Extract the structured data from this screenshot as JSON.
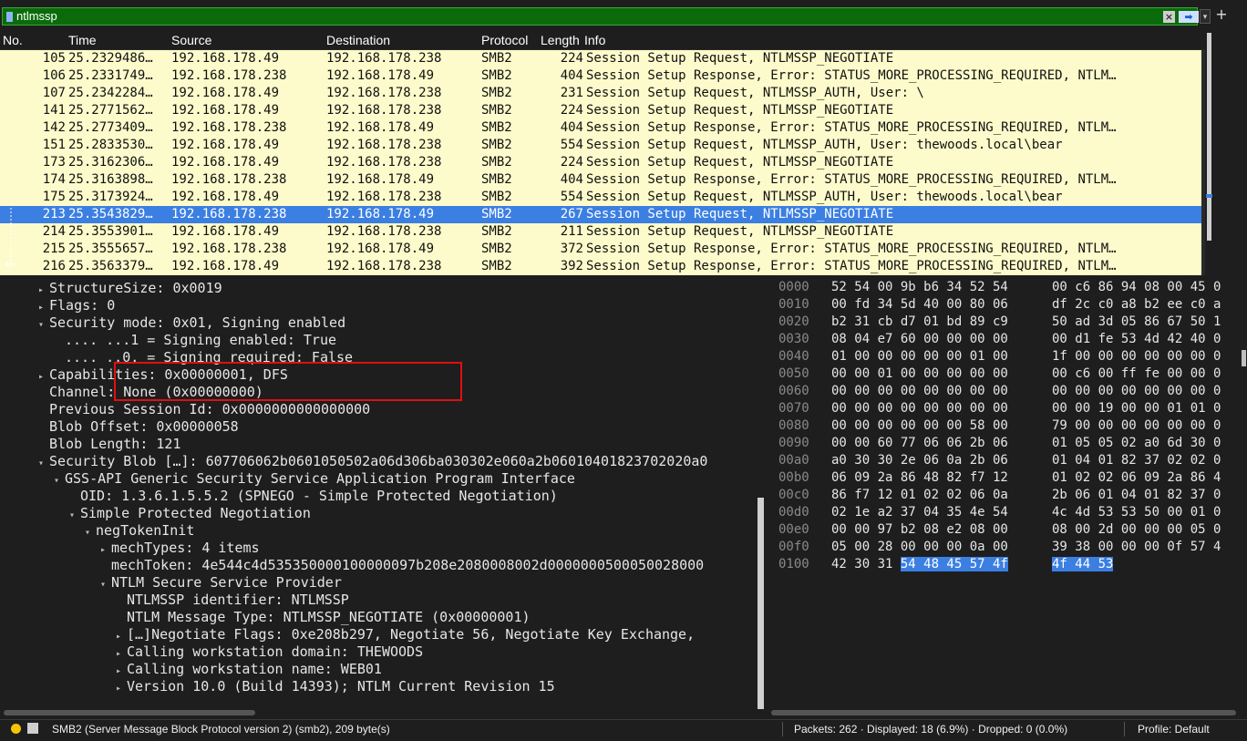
{
  "filter": {
    "value": "ntlmssp"
  },
  "columns": [
    "No.",
    "Time",
    "Source",
    "Destination",
    "Protocol",
    "Length",
    "Info"
  ],
  "packets": [
    {
      "no": "105",
      "time": "25.2329486…",
      "src": "192.168.178.49",
      "dst": "192.168.178.238",
      "proto": "SMB2",
      "len": "224",
      "info": "Session Setup Request, NTLMSSP_NEGOTIATE"
    },
    {
      "no": "106",
      "time": "25.2331749…",
      "src": "192.168.178.238",
      "dst": "192.168.178.49",
      "proto": "SMB2",
      "len": "404",
      "info": "Session Setup Response, Error: STATUS_MORE_PROCESSING_REQUIRED, NTLM…"
    },
    {
      "no": "107",
      "time": "25.2342284…",
      "src": "192.168.178.49",
      "dst": "192.168.178.238",
      "proto": "SMB2",
      "len": "231",
      "info": "Session Setup Request, NTLMSSP_AUTH, User: \\"
    },
    {
      "no": "141",
      "time": "25.2771562…",
      "src": "192.168.178.49",
      "dst": "192.168.178.238",
      "proto": "SMB2",
      "len": "224",
      "info": "Session Setup Request, NTLMSSP_NEGOTIATE"
    },
    {
      "no": "142",
      "time": "25.2773409…",
      "src": "192.168.178.238",
      "dst": "192.168.178.49",
      "proto": "SMB2",
      "len": "404",
      "info": "Session Setup Response, Error: STATUS_MORE_PROCESSING_REQUIRED, NTLM…"
    },
    {
      "no": "151",
      "time": "25.2833530…",
      "src": "192.168.178.49",
      "dst": "192.168.178.238",
      "proto": "SMB2",
      "len": "554",
      "info": "Session Setup Request, NTLMSSP_AUTH, User: thewoods.local\\bear"
    },
    {
      "no": "173",
      "time": "25.3162306…",
      "src": "192.168.178.49",
      "dst": "192.168.178.238",
      "proto": "SMB2",
      "len": "224",
      "info": "Session Setup Request, NTLMSSP_NEGOTIATE"
    },
    {
      "no": "174",
      "time": "25.3163898…",
      "src": "192.168.178.238",
      "dst": "192.168.178.49",
      "proto": "SMB2",
      "len": "404",
      "info": "Session Setup Response, Error: STATUS_MORE_PROCESSING_REQUIRED, NTLM…"
    },
    {
      "no": "175",
      "time": "25.3173924…",
      "src": "192.168.178.49",
      "dst": "192.168.178.238",
      "proto": "SMB2",
      "len": "554",
      "info": "Session Setup Request, NTLMSSP_AUTH, User: thewoods.local\\bear"
    },
    {
      "no": "213",
      "time": "25.3543829…",
      "src": "192.168.178.238",
      "dst": "192.168.178.49",
      "proto": "SMB2",
      "len": "267",
      "info": "Session Setup Request, NTLMSSP_NEGOTIATE"
    },
    {
      "no": "214",
      "time": "25.3553901…",
      "src": "192.168.178.49",
      "dst": "192.168.178.238",
      "proto": "SMB2",
      "len": "211",
      "info": "Session Setup Request, NTLMSSP_NEGOTIATE"
    },
    {
      "no": "215",
      "time": "25.3555657…",
      "src": "192.168.178.238",
      "dst": "192.168.178.49",
      "proto": "SMB2",
      "len": "372",
      "info": "Session Setup Response, Error: STATUS_MORE_PROCESSING_REQUIRED, NTLM…"
    },
    {
      "no": "216",
      "time": "25.3563379…",
      "src": "192.168.178.49",
      "dst": "192.168.178.238",
      "proto": "SMB2",
      "len": "392",
      "info": "Session Setup Response, Error: STATUS_MORE_PROCESSING_REQUIRED, NTLM…"
    }
  ],
  "selected_packet": "213",
  "details": [
    {
      "indent": 0,
      "tri": "right",
      "text": "StructureSize: 0x0019"
    },
    {
      "indent": 0,
      "tri": "right",
      "text": "Flags: 0"
    },
    {
      "indent": 0,
      "tri": "down",
      "text": "Security mode: 0x01, Signing enabled"
    },
    {
      "indent": 1,
      "tri": "none",
      "text": ".... ...1 = Signing enabled: True"
    },
    {
      "indent": 1,
      "tri": "none",
      "text": ".... ..0. = Signing required: False"
    },
    {
      "indent": 0,
      "tri": "right",
      "text": "Capabilities: 0x00000001, DFS"
    },
    {
      "indent": 0,
      "tri": "none",
      "text": "Channel: None (0x00000000)"
    },
    {
      "indent": 0,
      "tri": "none",
      "text": "Previous Session Id: 0x0000000000000000"
    },
    {
      "indent": 0,
      "tri": "none",
      "text": "Blob Offset: 0x00000058"
    },
    {
      "indent": 0,
      "tri": "none",
      "text": "Blob Length: 121"
    },
    {
      "indent": 0,
      "tri": "down",
      "text": "Security Blob […]: 607706062b0601050502a06d306ba030302e060a2b06010401823702020a0"
    },
    {
      "indent": 1,
      "tri": "down",
      "text": "GSS-API Generic Security Service Application Program Interface"
    },
    {
      "indent": 2,
      "tri": "none",
      "text": "OID: 1.3.6.1.5.5.2 (SPNEGO - Simple Protected Negotiation)"
    },
    {
      "indent": 2,
      "tri": "down",
      "text": "Simple Protected Negotiation"
    },
    {
      "indent": 3,
      "tri": "down",
      "text": "negTokenInit"
    },
    {
      "indent": 4,
      "tri": "right",
      "text": "mechTypes: 4 items"
    },
    {
      "indent": 4,
      "tri": "none",
      "text": "mechToken: 4e544c4d535350000100000097b208e2080008002d0000000500050028000"
    },
    {
      "indent": 4,
      "tri": "down",
      "text": "NTLM Secure Service Provider"
    },
    {
      "indent": 5,
      "tri": "none",
      "text": "NTLMSSP identifier: NTLMSSP"
    },
    {
      "indent": 5,
      "tri": "none",
      "text": "NTLM Message Type: NTLMSSP_NEGOTIATE (0x00000001)"
    },
    {
      "indent": 5,
      "tri": "right",
      "text": "[…]Negotiate Flags: 0xe208b297, Negotiate 56, Negotiate Key Exchange,"
    },
    {
      "indent": 5,
      "tri": "right",
      "text": "Calling workstation domain: THEWOODS"
    },
    {
      "indent": 5,
      "tri": "right",
      "text": "Calling workstation name: WEB01"
    },
    {
      "indent": 5,
      "tri": "right",
      "text": "Version 10.0 (Build 14393); NTLM Current Revision 15"
    }
  ],
  "hex": [
    {
      "off": "0000",
      "b1": "52 54 00 9b b6 34 52 54",
      "b2": "00 c6 86 94 08 00 45 0"
    },
    {
      "off": "0010",
      "b1": "00 fd 34 5d 40 00 80 06",
      "b2": "df 2c c0 a8 b2 ee c0 a"
    },
    {
      "off": "0020",
      "b1": "b2 31 cb d7 01 bd 89 c9",
      "b2": "50 ad 3d 05 86 67 50 1"
    },
    {
      "off": "0030",
      "b1": "08 04 e7 60 00 00 00 00",
      "b2": "00 d1 fe 53 4d 42 40 0"
    },
    {
      "off": "0040",
      "b1": "01 00 00 00 00 00 01 00",
      "b2": "1f 00 00 00 00 00 00 0"
    },
    {
      "off": "0050",
      "b1": "00 00 01 00 00 00 00 00",
      "b2": "00 c6 00 ff fe 00 00 0"
    },
    {
      "off": "0060",
      "b1": "00 00 00 00 00 00 00 00",
      "b2": "00 00 00 00 00 00 00 0"
    },
    {
      "off": "0070",
      "b1": "00 00 00 00 00 00 00 00",
      "b2": "00 00 19 00 00 01 01 0"
    },
    {
      "off": "0080",
      "b1": "00 00 00 00 00 00 58 00",
      "b2": "79 00 00 00 00 00 00 0"
    },
    {
      "off": "0090",
      "b1": "00 00 60 77 06 06 2b 06",
      "b2": "01 05 05 02 a0 6d 30 0"
    },
    {
      "off": "00a0",
      "b1": "a0 30 30 2e 06 0a 2b 06",
      "b2": "01 04 01 82 37 02 02 0"
    },
    {
      "off": "00b0",
      "b1": "06 09 2a 86 48 82 f7 12",
      "b2": "01 02 02 06 09 2a 86 4"
    },
    {
      "off": "00c0",
      "b1": "86 f7 12 01 02 02 06 0a",
      "b2": "2b 06 01 04 01 82 37 0"
    },
    {
      "off": "00d0",
      "b1": "02 1e a2 37 04 35 4e 54",
      "b2": "4c 4d 53 53 50 00 01 0"
    },
    {
      "off": "00e0",
      "b1": "00 00 97 b2 08 e2 08 00",
      "b2": "08 00 2d 00 00 00 05 0"
    },
    {
      "off": "00f0",
      "b1": "05 00 28 00 00 00 0a 00",
      "b2": "39 38 00 00 00 0f 57 4"
    },
    {
      "off": "0100",
      "b1_plain": "42 30 31 ",
      "b1_sel": "54 48 45 57 4f",
      "b2_sel": "4f 44 53"
    }
  ],
  "status": {
    "protocol": "SMB2 (Server Message Block Protocol version 2) (smb2), 209 byte(s)",
    "packets": "Packets: 262 · Displayed: 18 (6.9%) · Dropped: 0 (0.0%)",
    "profile": "Profile: Default"
  },
  "colors": {
    "filter_valid": "#0b6b0b",
    "row_bg": "#fdfbcb",
    "row_selected": "#3b7fe2",
    "highlight_box": "#e01010"
  }
}
